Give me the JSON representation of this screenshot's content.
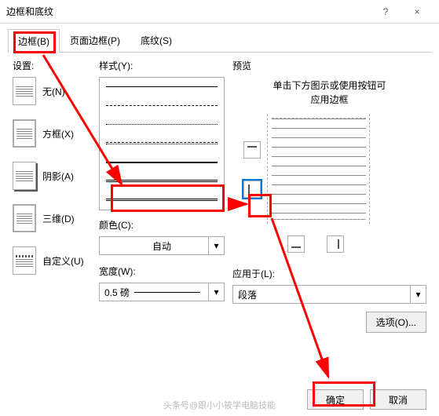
{
  "window": {
    "title": "边框和底纹",
    "help": "?",
    "close": "×"
  },
  "tabs": {
    "border": "边框(B)",
    "pageBorder": "页面边框(P)",
    "shading": "底纹(S)"
  },
  "settings": {
    "label": "设置:",
    "none": "无(N)",
    "box": "方框(X)",
    "shadow": "阴影(A)",
    "threed": "三维(D)",
    "custom": "自定义(U)"
  },
  "style": {
    "label": "样式(Y):"
  },
  "color": {
    "label": "颜色(C):",
    "value": "自动"
  },
  "width": {
    "label": "宽度(W):",
    "value": "0.5 磅"
  },
  "preview": {
    "label": "预览",
    "msg1": "单击下方图示或使用按钮可",
    "msg2": "应用边框"
  },
  "applyTo": {
    "label": "应用于(L):",
    "value": "段落"
  },
  "options": "选项(O)...",
  "buttons": {
    "ok": "确定",
    "cancel": "取消"
  },
  "watermark": "头条号@跟小小筱学电脑技能"
}
